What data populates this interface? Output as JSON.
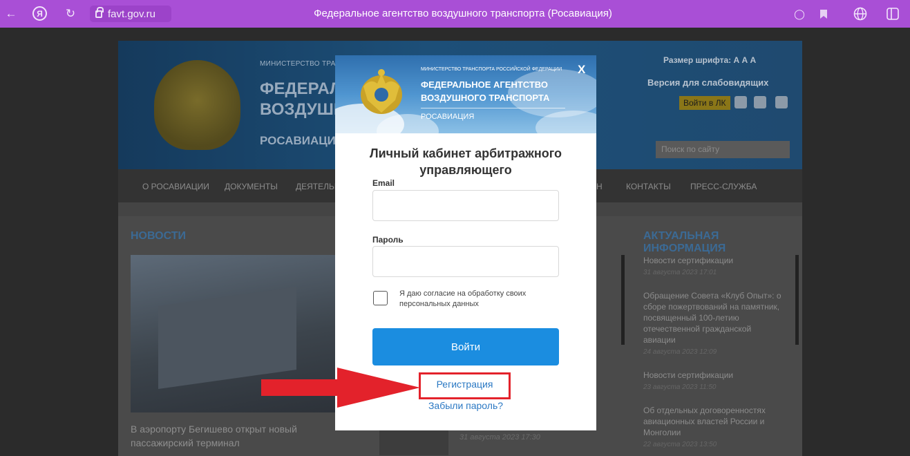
{
  "browser": {
    "url": "favt.gov.ru",
    "tab_title": "Федеральное агентство воздушного транспорта (Росавиация)",
    "accent": "#a94fd6"
  },
  "site": {
    "ministry": "МИНИСТЕРСТВО ТРАНСПОРТА",
    "agency_line1": "ФЕДЕРАЛЬНОЕ",
    "agency_line2": "ВОЗДУШНОГО",
    "rosaviatsiya": "РОСАВИАЦИЯ",
    "font_size_label": "Размер шрифта: А А А",
    "vision_label": "Версия для слабовидящих",
    "lk_button": "Войти в ЛК",
    "search_placeholder": "Поиск по сайту",
    "nav": [
      "О РОСАВИАЦИИ",
      "ДОКУМЕНТЫ",
      "ДЕЯТЕЛЬН",
      "Н",
      "КОНТАКТЫ",
      "ПРЕСС-СЛУЖБА"
    ],
    "news_heading": "НОВОСТИ",
    "news_text": "В аэропорту Бегишево открыт новый пассажирский терминал",
    "mid_date": "31 августа 2023 17:30",
    "actual_heading": "АКТУАЛЬНАЯ ИНФОРМАЦИЯ",
    "actual": [
      {
        "title": "Новости сертификации",
        "date": "31 августа 2023 17:01"
      },
      {
        "title": "Обращение Совета «Клуб Опыт»: о сборе пожертвований на памятник, посвященный 100-летию отечественной гражданской авиации",
        "date": "24 августа 2023 12:09"
      },
      {
        "title": "Новости сертификации",
        "date": "23 августа 2023 11:50"
      },
      {
        "title": "Об отдельных договоренностях авиационных властей России и Монголии",
        "date": "22 августа 2023 13:50"
      }
    ]
  },
  "modal": {
    "ministry": "МИНИСТЕРСТВО ТРАНСПОРТА РОССИЙСКОЙ ФЕДЕРАЦИИ",
    "agency_line1": "ФЕДЕРАЛЬНОЕ АГЕНТСТВО",
    "agency_line2": "ВОЗДУШНОГО ТРАНСПОРТА",
    "rosaviatsiya": "РОСАВИАЦИЯ",
    "close": "X",
    "title": "Личный кабинет арбитражного управляющего",
    "email_label": "Email",
    "email_value": "",
    "password_label": "Пароль",
    "password_value": "",
    "consent_text": "Я даю согласие на обработку своих персональных данных",
    "consent_checked": false,
    "login_button": "Войти",
    "register_link": "Регистрация",
    "forgot_link": "Забыли пароль?",
    "button_color": "#1b8de0",
    "highlight_color": "#e3222b"
  }
}
